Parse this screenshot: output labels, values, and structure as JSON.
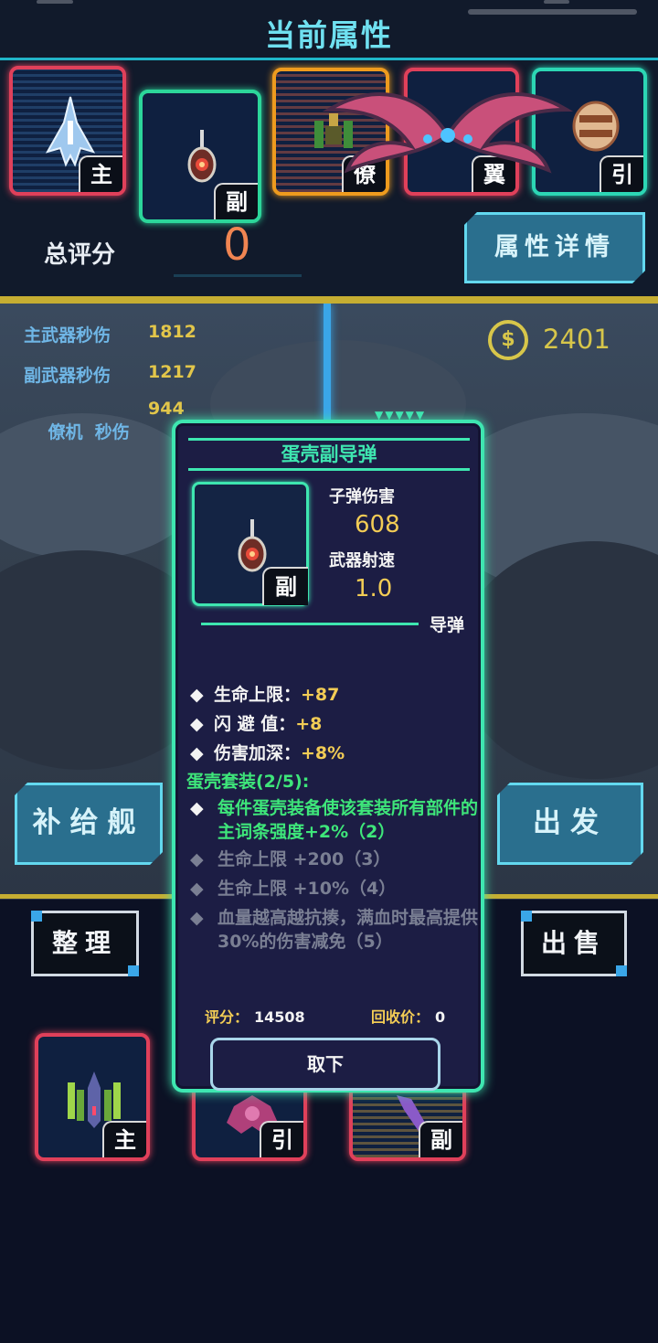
{
  "header": {
    "title": "当前属性",
    "score_label": "总评分",
    "score_value": "0",
    "detail_button": "属性详情"
  },
  "equipped_slots": [
    {
      "tag": "主",
      "border": "#e0405a"
    },
    {
      "tag": "副",
      "border": "#2cd69a"
    },
    {
      "tag": "僚",
      "border": "#ee9b1e"
    },
    {
      "tag": "翼",
      "border": "#e0405a"
    },
    {
      "tag": "引",
      "border": "#2cd6b4"
    }
  ],
  "stats": [
    {
      "label": "主武器秒伤",
      "value": "1812"
    },
    {
      "label": "副武器秒伤",
      "value": "1217"
    },
    {
      "label": "僚机  秒伤",
      "value": "944"
    }
  ],
  "currency": {
    "icon": "coin-icon",
    "value": "2401"
  },
  "buttons": {
    "supply": "补给舰",
    "depart": "出发",
    "sort": "整理",
    "sell": "出售"
  },
  "inventory": [
    {
      "tag": "主",
      "border": "#e0405a"
    },
    {
      "tag": "引",
      "border": "#e0405a"
    },
    {
      "tag": "副",
      "border": "#e0405a"
    }
  ],
  "popup": {
    "name": "蛋壳副导弹",
    "slot_tag": "副",
    "bullet_damage_label": "子弹伤害",
    "bullet_damage": "608",
    "fire_rate_label": "武器射速",
    "fire_rate": "1.0",
    "weapon_type": "导弹",
    "attributes": [
      {
        "label": "生命上限：",
        "value": "+87"
      },
      {
        "label": "闪 避 值：",
        "value": "+8"
      },
      {
        "label": "伤害加深：",
        "value": "+8%"
      }
    ],
    "set_title": "蛋壳套装(2/5):",
    "set_bonuses": [
      {
        "text": "每件蛋壳装备使该套装所有部件的主词条强度+2%（2）",
        "active": true
      },
      {
        "text": "生命上限 +200（3）",
        "active": false
      },
      {
        "text": "生命上限 +10%（4）",
        "active": false
      },
      {
        "text": "血量越高越抗揍，满血时最高提供30%的伤害减免（5）",
        "active": false
      }
    ],
    "score_label": "评分：",
    "score_value": "14508",
    "recycle_label": "回收价：",
    "recycle_value": "0",
    "remove_button": "取下"
  },
  "colors": {
    "accent_cyan": "#6fe0f0",
    "popup_green": "#3ee6b0",
    "gold": "#f2cc55",
    "score_orange": "#f08552"
  }
}
